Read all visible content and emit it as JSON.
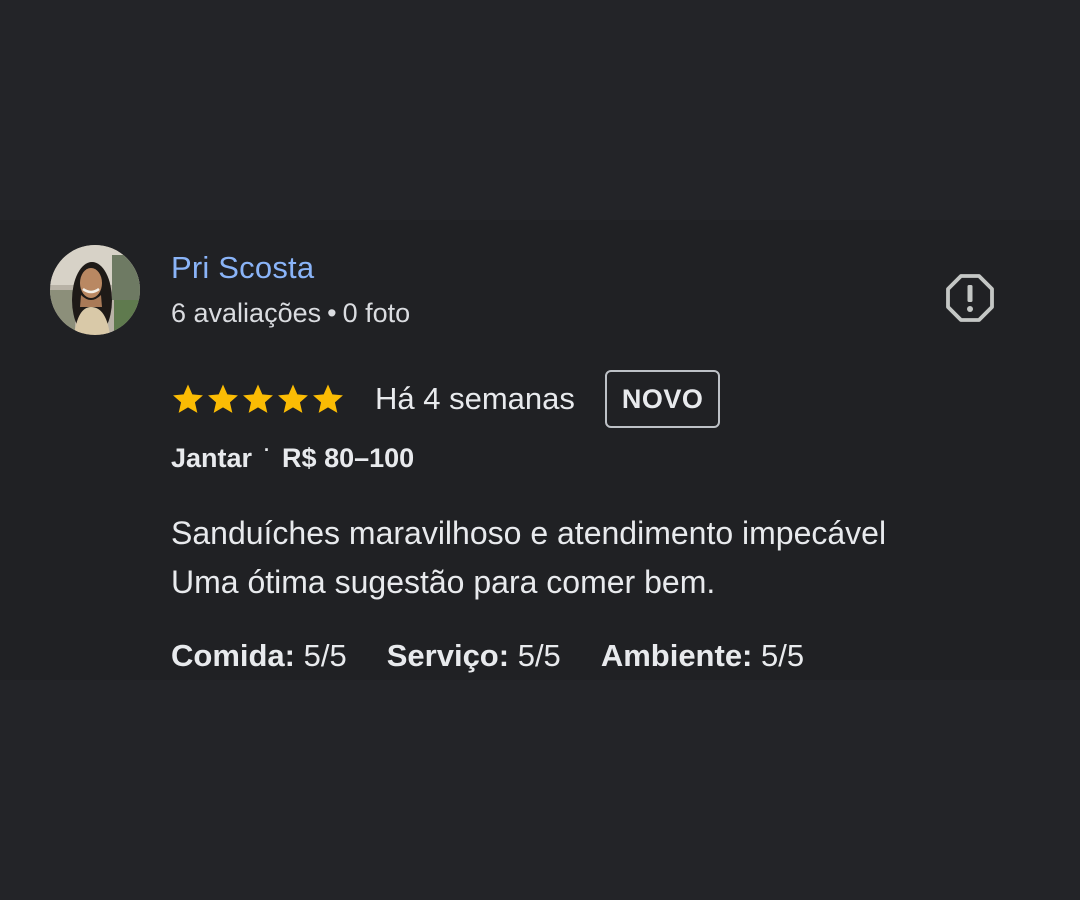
{
  "review": {
    "author": {
      "name": "Pri Scosta",
      "reviews_count": "6 avaliações",
      "separator": "•",
      "photos_count": "0 foto",
      "avatar_icon": "profile-photo"
    },
    "report_icon": "report-flag-icon",
    "rating": {
      "stars": 5,
      "max_stars": 5,
      "star_color": "#fbbc04"
    },
    "date": "Há 4 semanas",
    "badge": "NOVO",
    "meal_type": "Jantar",
    "meta_separator": "·",
    "price_range": "R$ 80–100",
    "text_lines": [
      "Sanduíches maravilhoso e atendimento impecável",
      "Uma ótima sugestão para comer bem."
    ],
    "aspects": [
      {
        "label": "Comida:",
        "value": "5/5"
      },
      {
        "label": "Serviço:",
        "value": "5/5"
      },
      {
        "label": "Ambiente:",
        "value": "5/5"
      }
    ]
  },
  "colors": {
    "background": "#232428",
    "card": "#202124",
    "author_link": "#8ab4f8",
    "text": "#e8eaed",
    "star": "#fbbc04"
  }
}
